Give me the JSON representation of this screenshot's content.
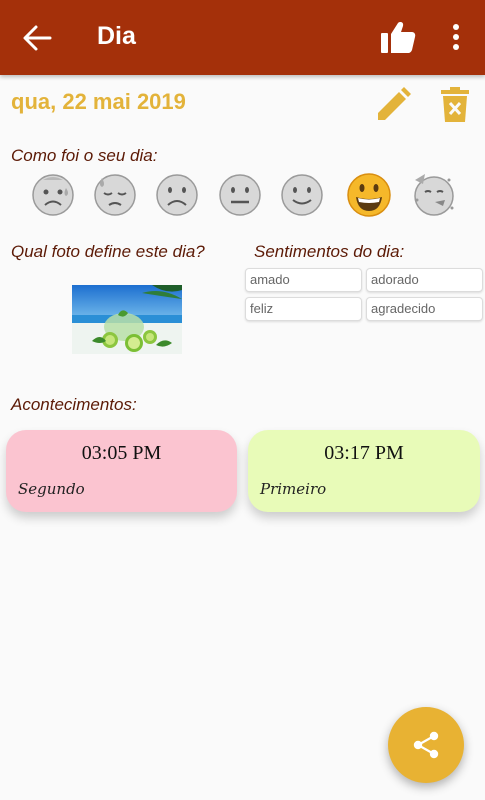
{
  "appbar": {
    "title": "Dia",
    "back_icon": "arrow-back-icon",
    "like_icon": "thumbs-up-icon",
    "menu_icon": "more-vert-icon",
    "color": "#a4300a"
  },
  "date": {
    "text": "qua, 22 mai 2019",
    "color": "#e3b33a"
  },
  "labels": {
    "mood_question": "Como foi o seu dia:",
    "photo_question": "Qual foto define este dia?",
    "feelings_title": "Sentimentos do dia:",
    "events_title": "Acontecimentos:"
  },
  "moods": [
    {
      "name": "anxious-sweat-face",
      "selected": false
    },
    {
      "name": "downcast-sweat-face",
      "selected": false
    },
    {
      "name": "frowning-face",
      "selected": false
    },
    {
      "name": "neutral-face",
      "selected": false
    },
    {
      "name": "slightly-smiling-face",
      "selected": false
    },
    {
      "name": "grinning-face",
      "selected": true
    },
    {
      "name": "partying-face",
      "selected": false
    }
  ],
  "feelings": [
    "amado",
    "adorado",
    "feliz",
    "agradecido"
  ],
  "events": [
    {
      "time": "03:05 PM",
      "note": "Segundo",
      "color": "#fbc4d0"
    },
    {
      "time": "03:17 PM",
      "note": "Primeiro",
      "color": "#e8fbb8"
    }
  ],
  "fab": {
    "icon": "share-icon",
    "color": "#e8b233"
  }
}
